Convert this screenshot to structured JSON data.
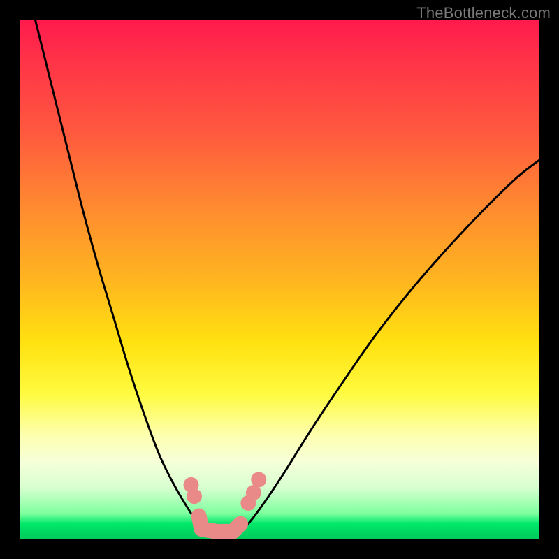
{
  "watermark": "TheBottleneck.com",
  "colors": {
    "frame": "#000000",
    "gradient_top": "#ff1a4d",
    "gradient_mid": "#ffe110",
    "gradient_bottom": "#00c95a",
    "curve": "#000000",
    "marker": "#e98a88"
  },
  "chart_data": {
    "type": "line",
    "title": "",
    "xlabel": "",
    "ylabel": "",
    "xlim": [
      0,
      100
    ],
    "ylim": [
      0,
      100
    ],
    "grid": false,
    "legend": "none",
    "series": [
      {
        "name": "left-curve",
        "x": [
          3,
          6,
          9,
          12,
          15,
          18,
          21,
          24,
          27,
          30,
          33,
          35,
          36
        ],
        "values": [
          100,
          88,
          76,
          64,
          53,
          43,
          33,
          24,
          16,
          10,
          5,
          2,
          1
        ]
      },
      {
        "name": "right-curve",
        "x": [
          42,
          44,
          47,
          51,
          56,
          62,
          69,
          77,
          86,
          95,
          100
        ],
        "values": [
          1,
          3,
          7,
          13,
          21,
          30,
          40,
          50,
          60,
          69,
          73
        ]
      }
    ],
    "markers": [
      {
        "name": "left-dot-upper",
        "x": 33.0,
        "y": 10.5
      },
      {
        "name": "left-dot-lower",
        "x": 33.6,
        "y": 8.3
      },
      {
        "name": "right-dot-1",
        "x": 44.0,
        "y": 7.0
      },
      {
        "name": "right-dot-2",
        "x": 45.0,
        "y": 9.0
      },
      {
        "name": "right-dot-3",
        "x": 46.0,
        "y": 11.5
      }
    ],
    "sausage": {
      "name": "bottom-sausage",
      "points": [
        {
          "x": 34.5,
          "y": 4.5
        },
        {
          "x": 35.0,
          "y": 2.0
        },
        {
          "x": 38.0,
          "y": 1.5
        },
        {
          "x": 41.0,
          "y": 1.5
        },
        {
          "x": 42.5,
          "y": 3.0
        }
      ]
    }
  }
}
